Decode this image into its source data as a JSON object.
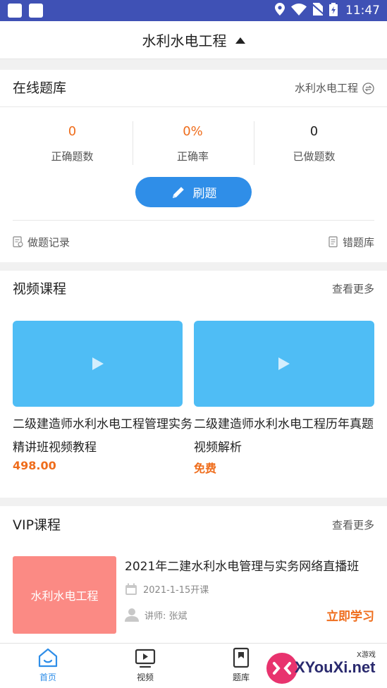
{
  "status_bar": {
    "time": "11:47",
    "background": "#3f51b5",
    "icons": [
      "app-square-icon",
      "app-square-icon",
      "location-icon",
      "wifi-icon",
      "no-sim-icon",
      "battery-charging-icon"
    ]
  },
  "header": {
    "title": "水利水电工程"
  },
  "question_bank": {
    "title": "在线题库",
    "subject": "水利水电工程",
    "stats": [
      {
        "value": "0",
        "label": "正确题数",
        "color": "#ef6d1c"
      },
      {
        "value": "0%",
        "label": "正确率",
        "color": "#ef6d1c"
      },
      {
        "value": "0",
        "label": "已做题数",
        "color": "#222222"
      }
    ],
    "practice_button": "刷题",
    "links": {
      "record": "做题记录",
      "wrong": "错题库"
    }
  },
  "video_courses": {
    "title": "视频课程",
    "more": "查看更多",
    "items": [
      {
        "title": "二级建造师水利水电工程管理实务精讲班视频教程",
        "price": "498.00"
      },
      {
        "title": "二级建造师水利水电工程历年真题视频解析",
        "price": "免费"
      }
    ]
  },
  "vip_courses": {
    "title": "VIP课程",
    "more": "查看更多",
    "item": {
      "thumb_text": "水利水电工程",
      "title": "2021年二建水利水电管理与实务网络直播班",
      "date": "2021-1-15开课",
      "teacher": "讲师: 张斌",
      "action": "立即学习"
    }
  },
  "tabbar": {
    "tabs": [
      {
        "label": "首页",
        "active": true
      },
      {
        "label": "视频",
        "active": false
      },
      {
        "label": "题库",
        "active": false
      }
    ]
  },
  "watermark": {
    "text": "XYouXi.net",
    "sub": "X游戏"
  },
  "colors": {
    "accent": "#2f8ee8",
    "orange": "#ef6d1c",
    "thumb_blue": "#4fbdf5",
    "vip_thumb": "#fb8a84"
  }
}
